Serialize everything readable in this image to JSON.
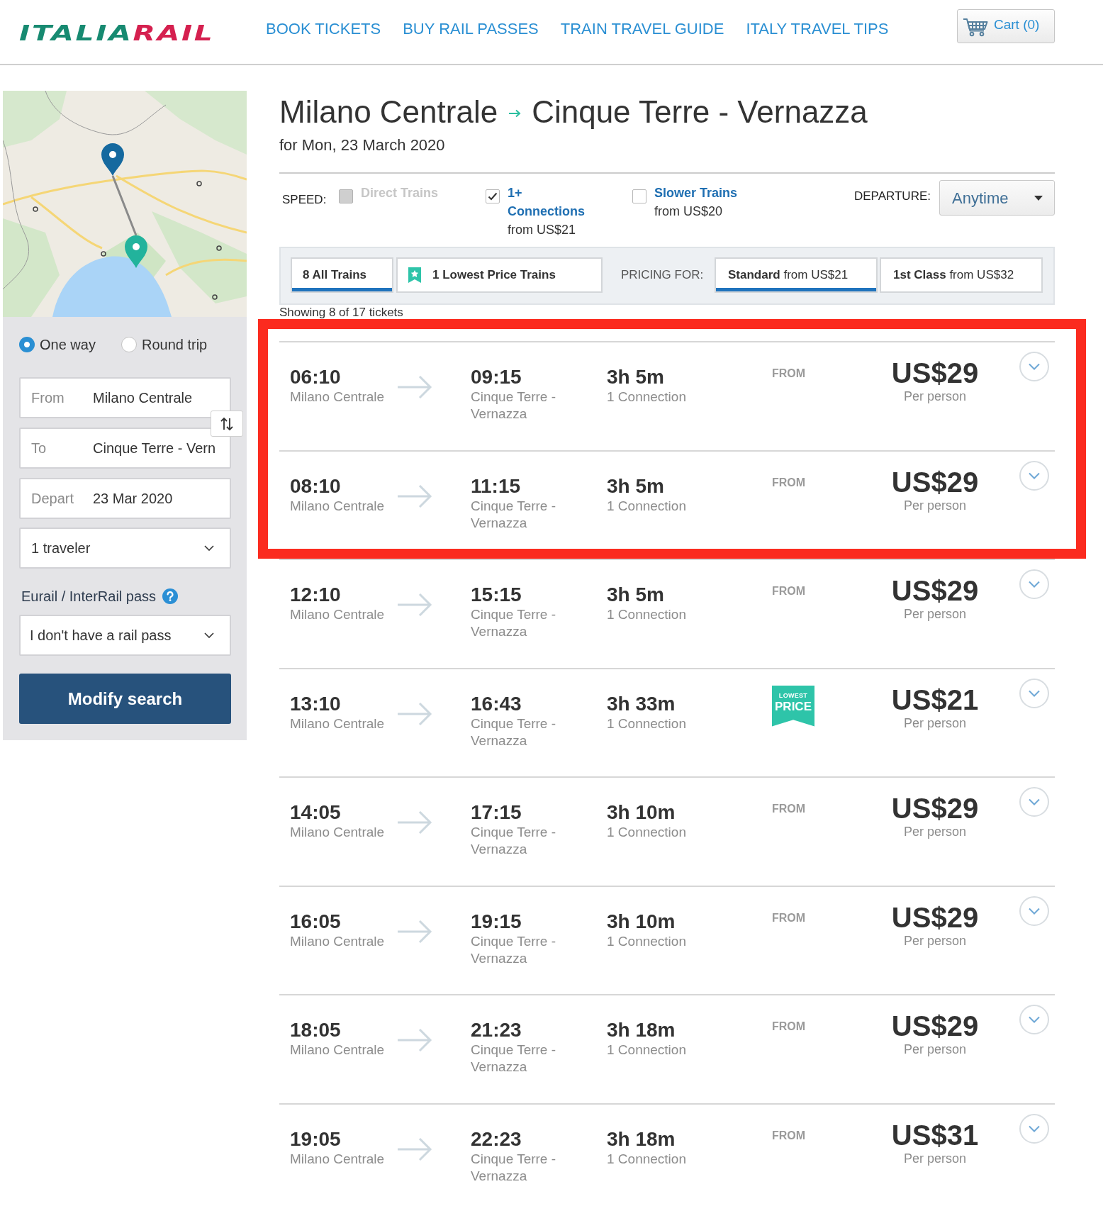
{
  "header": {
    "logo": [
      "ITALIA",
      "RAIL"
    ],
    "nav": [
      "BOOK TICKETS",
      "BUY RAIL PASSES",
      "TRAIN TRAVEL GUIDE",
      "ITALY TRAVEL TIPS"
    ],
    "cart": "Cart (0)"
  },
  "search": {
    "trip_type": [
      {
        "label": "One way",
        "selected": true
      },
      {
        "label": "Round trip",
        "selected": false
      }
    ],
    "fields": [
      {
        "label": "From",
        "value": "Milano Centrale"
      },
      {
        "label": "To",
        "value": "Cinque Terre - Vern"
      },
      {
        "label": "Depart",
        "value": "23 Mar 2020"
      }
    ],
    "travelers": "1 traveler",
    "rail_pass": {
      "label": "Eurail / InterRail pass",
      "value": "I don't have a rail pass"
    },
    "button": "Modify search"
  },
  "route": {
    "origin": "Milano Centrale",
    "destination": "Cinque Terre - Vernazza",
    "date": "for Mon, 23 March 2020"
  },
  "speed": {
    "label": "SPEED:",
    "options": [
      {
        "label": "Direct Trains",
        "checked": false,
        "disabled": true
      },
      {
        "label": "1+ Connections",
        "note": "from US$21",
        "checked": true,
        "disabled": false
      },
      {
        "label": "Slower Trains",
        "note": "from US$20",
        "checked": false,
        "disabled": false
      }
    ]
  },
  "departure": {
    "label": "DEPARTURE:",
    "value": "Anytime"
  },
  "train_tabs": [
    {
      "kind": "all",
      "label": "8 All Trains",
      "selected": true
    },
    {
      "kind": "lowest-price",
      "label": "1 Lowest Price Trains",
      "selected": false
    }
  ],
  "pricing": {
    "label": "PRICING FOR:",
    "tabs": [
      {
        "label": "**Standard** from US$21",
        "selected": true
      },
      {
        "label": "**1st Class** from US$32",
        "selected": false
      }
    ]
  },
  "showing": "Showing 8 of 17 tickets",
  "results": [
    {
      "depart": "06:10",
      "from": "Milano Centrale",
      "arrive": "09:15",
      "to": "Cinque Terre - Vernazza",
      "duration": "3h 5m",
      "connections": "1 Connection",
      "tag": {
        "kind": "label",
        "text": "FROM"
      },
      "price": "US$29",
      "price_note": "Per person",
      "highlighted": true
    },
    {
      "depart": "08:10",
      "from": "Milano Centrale",
      "arrive": "11:15",
      "to": "Cinque Terre - Vernazza",
      "duration": "3h 5m",
      "connections": "1 Connection",
      "tag": {
        "kind": "label",
        "text": "FROM"
      },
      "price": "US$29",
      "price_note": "Per person",
      "highlighted": true
    },
    {
      "depart": "12:10",
      "from": "Milano Centrale",
      "arrive": "15:15",
      "to": "Cinque Terre - Vernazza",
      "duration": "3h 5m",
      "connections": "1 Connection",
      "tag": {
        "kind": "label",
        "text": "FROM"
      },
      "price": "US$29",
      "price_note": "Per person",
      "highlighted": false
    },
    {
      "depart": "13:10",
      "from": "Milano Centrale",
      "arrive": "16:43",
      "to": "Cinque Terre - Vernazza",
      "duration": "3h 33m",
      "connections": "1 Connection",
      "tag": {
        "kind": "ribbon",
        "lines": [
          "LOWEST",
          "PRICE"
        ]
      },
      "price": "US$21",
      "price_note": "Per person",
      "highlighted": false
    },
    {
      "depart": "14:05",
      "from": "Milano Centrale",
      "arrive": "17:15",
      "to": "Cinque Terre - Vernazza",
      "duration": "3h 10m",
      "connections": "1 Connection",
      "tag": {
        "kind": "label",
        "text": "FROM"
      },
      "price": "US$29",
      "price_note": "Per person",
      "highlighted": false
    },
    {
      "depart": "16:05",
      "from": "Milano Centrale",
      "arrive": "19:15",
      "to": "Cinque Terre - Vernazza",
      "duration": "3h 10m",
      "connections": "1 Connection",
      "tag": {
        "kind": "label",
        "text": "FROM"
      },
      "price": "US$29",
      "price_note": "Per person",
      "highlighted": false
    },
    {
      "depart": "18:05",
      "from": "Milano Centrale",
      "arrive": "21:23",
      "to": "Cinque Terre - Vernazza",
      "duration": "3h 18m",
      "connections": "1 Connection",
      "tag": {
        "kind": "label",
        "text": "FROM"
      },
      "price": "US$29",
      "price_note": "Per person",
      "highlighted": false
    },
    {
      "depart": "19:05",
      "from": "Milano Centrale",
      "arrive": "22:23",
      "to": "Cinque Terre - Vernazza",
      "duration": "3h 18m",
      "connections": "1 Connection",
      "tag": {
        "kind": "label",
        "text": "FROM"
      },
      "price": "US$31",
      "price_note": "Per person",
      "highlighted": false
    }
  ]
}
